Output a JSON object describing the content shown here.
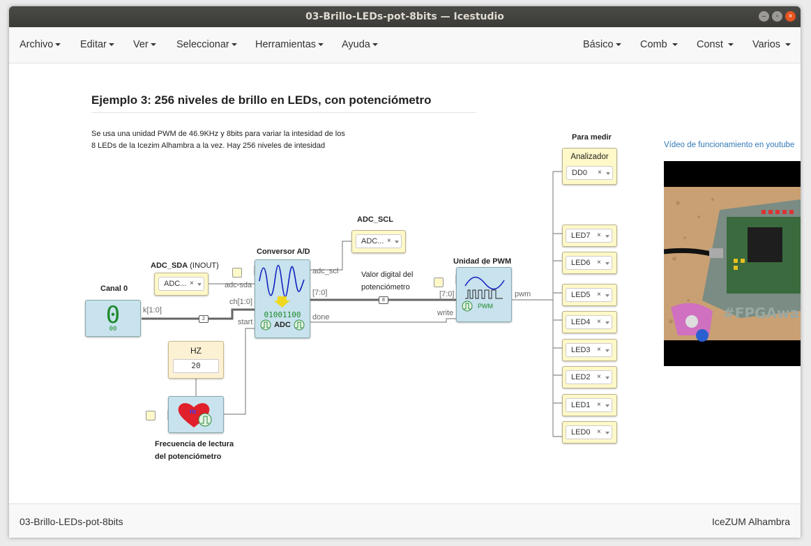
{
  "window": {
    "title": "03-Brillo-LEDs-pot-8bits — Icestudio"
  },
  "menu": {
    "left": [
      "Archivo",
      "Editar",
      "Ver",
      "Seleccionar",
      "Herramientas",
      "Ayuda"
    ],
    "right": [
      "Básico",
      "Comb",
      "Const",
      "Varios"
    ]
  },
  "diagram": {
    "heading": "Ejemplo 3: 256 niveles de brillo en LEDs, con potenciómetro",
    "description_line1": "Se usa una unidad PWM de 46.9KHz y 8bits para variar la intesidad de los",
    "description_line2": "8 LEDs de la Icezim Alhambra a la vez. Hay 256 niveles de intesidad",
    "para_medir": "Para medir",
    "youtube_link": "Vídeo de funcionamiento en youtube",
    "canal0": {
      "label": "Canal 0",
      "value": "0",
      "hex": "00",
      "port": "k[1:0]",
      "bus_width": "2"
    },
    "adc_sda": {
      "label_bold": "ADC_SDA",
      "label_suffix": " (INOUT)",
      "select": "ADC..."
    },
    "adc_scl": {
      "label": "ADC_SCL",
      "select": "ADC..."
    },
    "conversor": {
      "label": "Conversor A/D",
      "bits": "01001100",
      "name": "ADC",
      "ports_in": [
        "adc-sda",
        "ch[1:0]",
        "start"
      ],
      "ports_out": [
        "adc_scl",
        "[7:0]",
        "done"
      ]
    },
    "valor_digital": {
      "line1": "Valor digital del",
      "line2": "potenciómetro",
      "bus_width": "8"
    },
    "pwm": {
      "label": "Unidad de PWM",
      "name": "PWM",
      "ports_in": [
        "[7:0]",
        "write"
      ],
      "port_out": "pwm"
    },
    "hz": {
      "label": "HZ",
      "value": "20",
      "icon_text": "Hz"
    },
    "frecuencia": {
      "line1": "Frecuencia de lectura",
      "line2": "del potenciómetro"
    },
    "analizador": {
      "label": "Analizador",
      "select": "DD0"
    },
    "leds": [
      "LED7",
      "LED6",
      "LED5",
      "LED4",
      "LED3",
      "LED2",
      "LED1",
      "LED0"
    ]
  },
  "status": {
    "left": "03-Brillo-LEDs-pot-8bits",
    "right": "IceZUM Alhambra"
  },
  "colors": {
    "io_block": "#fff8c8",
    "module_block": "#c8e2ee",
    "close_button": "#e6541f",
    "link": "#337ab7"
  }
}
